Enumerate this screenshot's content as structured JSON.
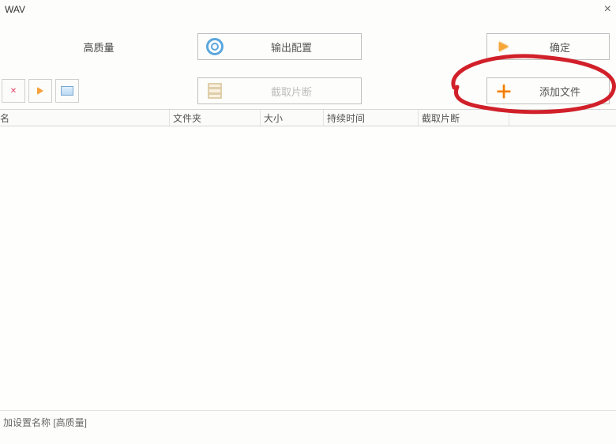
{
  "titlebar": {
    "title": "WAV",
    "close": "×"
  },
  "quality_label": "高质量",
  "buttons": {
    "output_config": "输出配置",
    "confirm": "确定",
    "trim": "截取片断",
    "add_file": "添加文件"
  },
  "icons": {
    "output_config": "gear-icon",
    "confirm": "arrow-right-icon",
    "trim": "film-icon",
    "add_file": "plus-icon",
    "media_close": "close-x-icon",
    "media_play": "play-icon",
    "media_view": "screen-icon"
  },
  "table": {
    "columns": {
      "filename": "名",
      "folder": "文件夹",
      "size": "大小",
      "duration": "持续时间",
      "trim": "截取片断"
    },
    "rows": []
  },
  "footer": {
    "text": "加设置名称 [高质量]"
  },
  "colors": {
    "accent_orange": "#f5a03a",
    "highlight_red": "#d1202a",
    "border_gray": "#bfbfbf"
  }
}
